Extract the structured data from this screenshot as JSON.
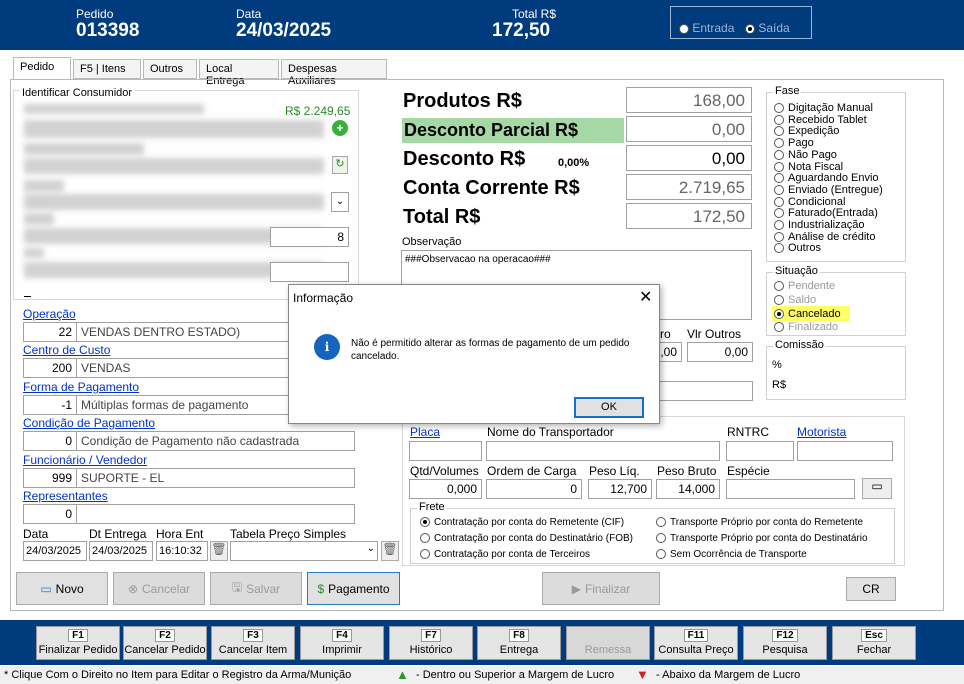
{
  "header": {
    "pedido_label": "Pedido",
    "pedido_value": "013398",
    "data_label": "Data",
    "data_value": "24/03/2025",
    "total_label": "Total R$",
    "total_value": "172,50",
    "entrada": "Entrada",
    "saida": "Saída"
  },
  "tabs": [
    "Pedido",
    "F5 | Itens",
    "Outros",
    "Local Entrega",
    "Despesas Auxiliares"
  ],
  "consumer": {
    "title": "Identificar Consumidor",
    "value_amount": "R$ 2.249,65",
    "number_suffix": "8"
  },
  "fields": {
    "operacao_label": "Operação",
    "operacao_code": "22",
    "operacao_desc": "VENDAS DENTRO ESTADO)",
    "centro_label": "Centro de Custo",
    "centro_code": "200",
    "centro_desc": "VENDAS",
    "forma_label": "Forma de Pagamento",
    "forma_code": "-1",
    "forma_desc": "Múltiplas formas de pagamento",
    "condicao_label": "Condição de Pagamento",
    "condicao_code": "0",
    "condicao_desc": "Condição de Pagamento não cadastrada",
    "func_label": "Funcionário / Vendedor",
    "func_code": "999",
    "func_desc": "SUPORTE - EL",
    "rep_label": "Representantes",
    "rep_code": "0",
    "data_label": "Data",
    "data_value": "24/03/2025",
    "entrega_label": "Dt Entrega",
    "entrega_value": "24/03/2025",
    "hora_label": "Hora Ent",
    "hora_value": "16:10:32",
    "tabela_label": "Tabela Preço Simples"
  },
  "totals": {
    "produtos_label": "Produtos R$",
    "produtos_value": "168,00",
    "desconto_parcial_label": "Desconto Parcial R$",
    "desconto_parcial_value": "0,00",
    "desconto_label": "Desconto R$",
    "desconto_pct": "0,00%",
    "desconto_value": "0,00",
    "conta_label": "Conta Corrente R$",
    "conta_value": "2.719,65",
    "total_label": "Total R$",
    "total_value": "172,50"
  },
  "obs": {
    "label": "Observação",
    "text": "###Observacao na operacao###"
  },
  "outros": {
    "partial_label": "ro",
    "partial_value": ",00",
    "vlr_label": "Vlr Outros",
    "vlr_value": "0,00"
  },
  "fase": {
    "title": "Fase",
    "items": [
      "Digitação Manual",
      "Recebido Tablet",
      "Expedição",
      "Pago",
      "Não Pago",
      "Nota Fiscal",
      "Aguardando Envio",
      "Enviado (Entregue)",
      "Condicional",
      "Faturado(Entrada)",
      "Industrialização",
      "Análise de crédito",
      "Outros"
    ]
  },
  "situacao": {
    "title": "Situação",
    "items": [
      "Pendente",
      "Saldo",
      "Cancelado",
      "Finalizado"
    ]
  },
  "comissao": {
    "title": "Comissão",
    "pct": "%",
    "rs": "R$"
  },
  "transporte": {
    "placa": "Placa",
    "nome": "Nome do Transportador",
    "rntrc": "RNTRC",
    "motorista": "Motorista",
    "qtd_label": "Qtd/Volumes",
    "qtd_value": "0,000",
    "ordem_label": "Ordem de Carga",
    "ordem_value": "0",
    "peso_liq_label": "Peso Líq.",
    "peso_liq_value": "12,700",
    "peso_bruto_label": "Peso Bruto",
    "peso_bruto_value": "14,000",
    "especie_label": "Espécie"
  },
  "frete": {
    "title": "Frete",
    "options": [
      "Contratação por conta do Remetente (CIF)",
      "Contratação por conta do Destinatário (FOB)",
      "Contratação por conta de Terceiros",
      "Transporte Próprio por conta do Remetente",
      "Transporte Próprio por conta do Destinatário",
      "Sem Ocorrência de Transporte"
    ]
  },
  "buttons": {
    "novo": "Novo",
    "cancelar": "Cancelar",
    "salvar": "Salvar",
    "pagamento": "Pagamento",
    "finalizar": "Finalizar",
    "cr": "CR"
  },
  "fkeys": [
    {
      "key": "F1",
      "label": "Finalizar Pedido"
    },
    {
      "key": "F2",
      "label": "Cancelar Pedido"
    },
    {
      "key": "F3",
      "label": "Cancelar Item"
    },
    {
      "key": "F4",
      "label": "Imprimir"
    },
    {
      "key": "F7",
      "label": "Histórico"
    },
    {
      "key": "F8",
      "label": "Entrega"
    },
    {
      "key": "",
      "label": "Remessa"
    },
    {
      "key": "F11",
      "label": "Consulta Preço"
    },
    {
      "key": "F12",
      "label": "Pesquisa"
    },
    {
      "key": "Esc",
      "label": "Fechar"
    }
  ],
  "status": {
    "hint": "* Clique Com o Direito no Item para Editar o Registro da Arma/Munição",
    "dentro": "- Dentro ou Superior a Margem de Lucro",
    "abaixo": "- Abaixo da Margem de Lucro"
  },
  "dialog": {
    "title": "Informação",
    "message": "Não é permitido alterar as formas de pagamento de um pedido cancelado.",
    "ok": "OK"
  }
}
